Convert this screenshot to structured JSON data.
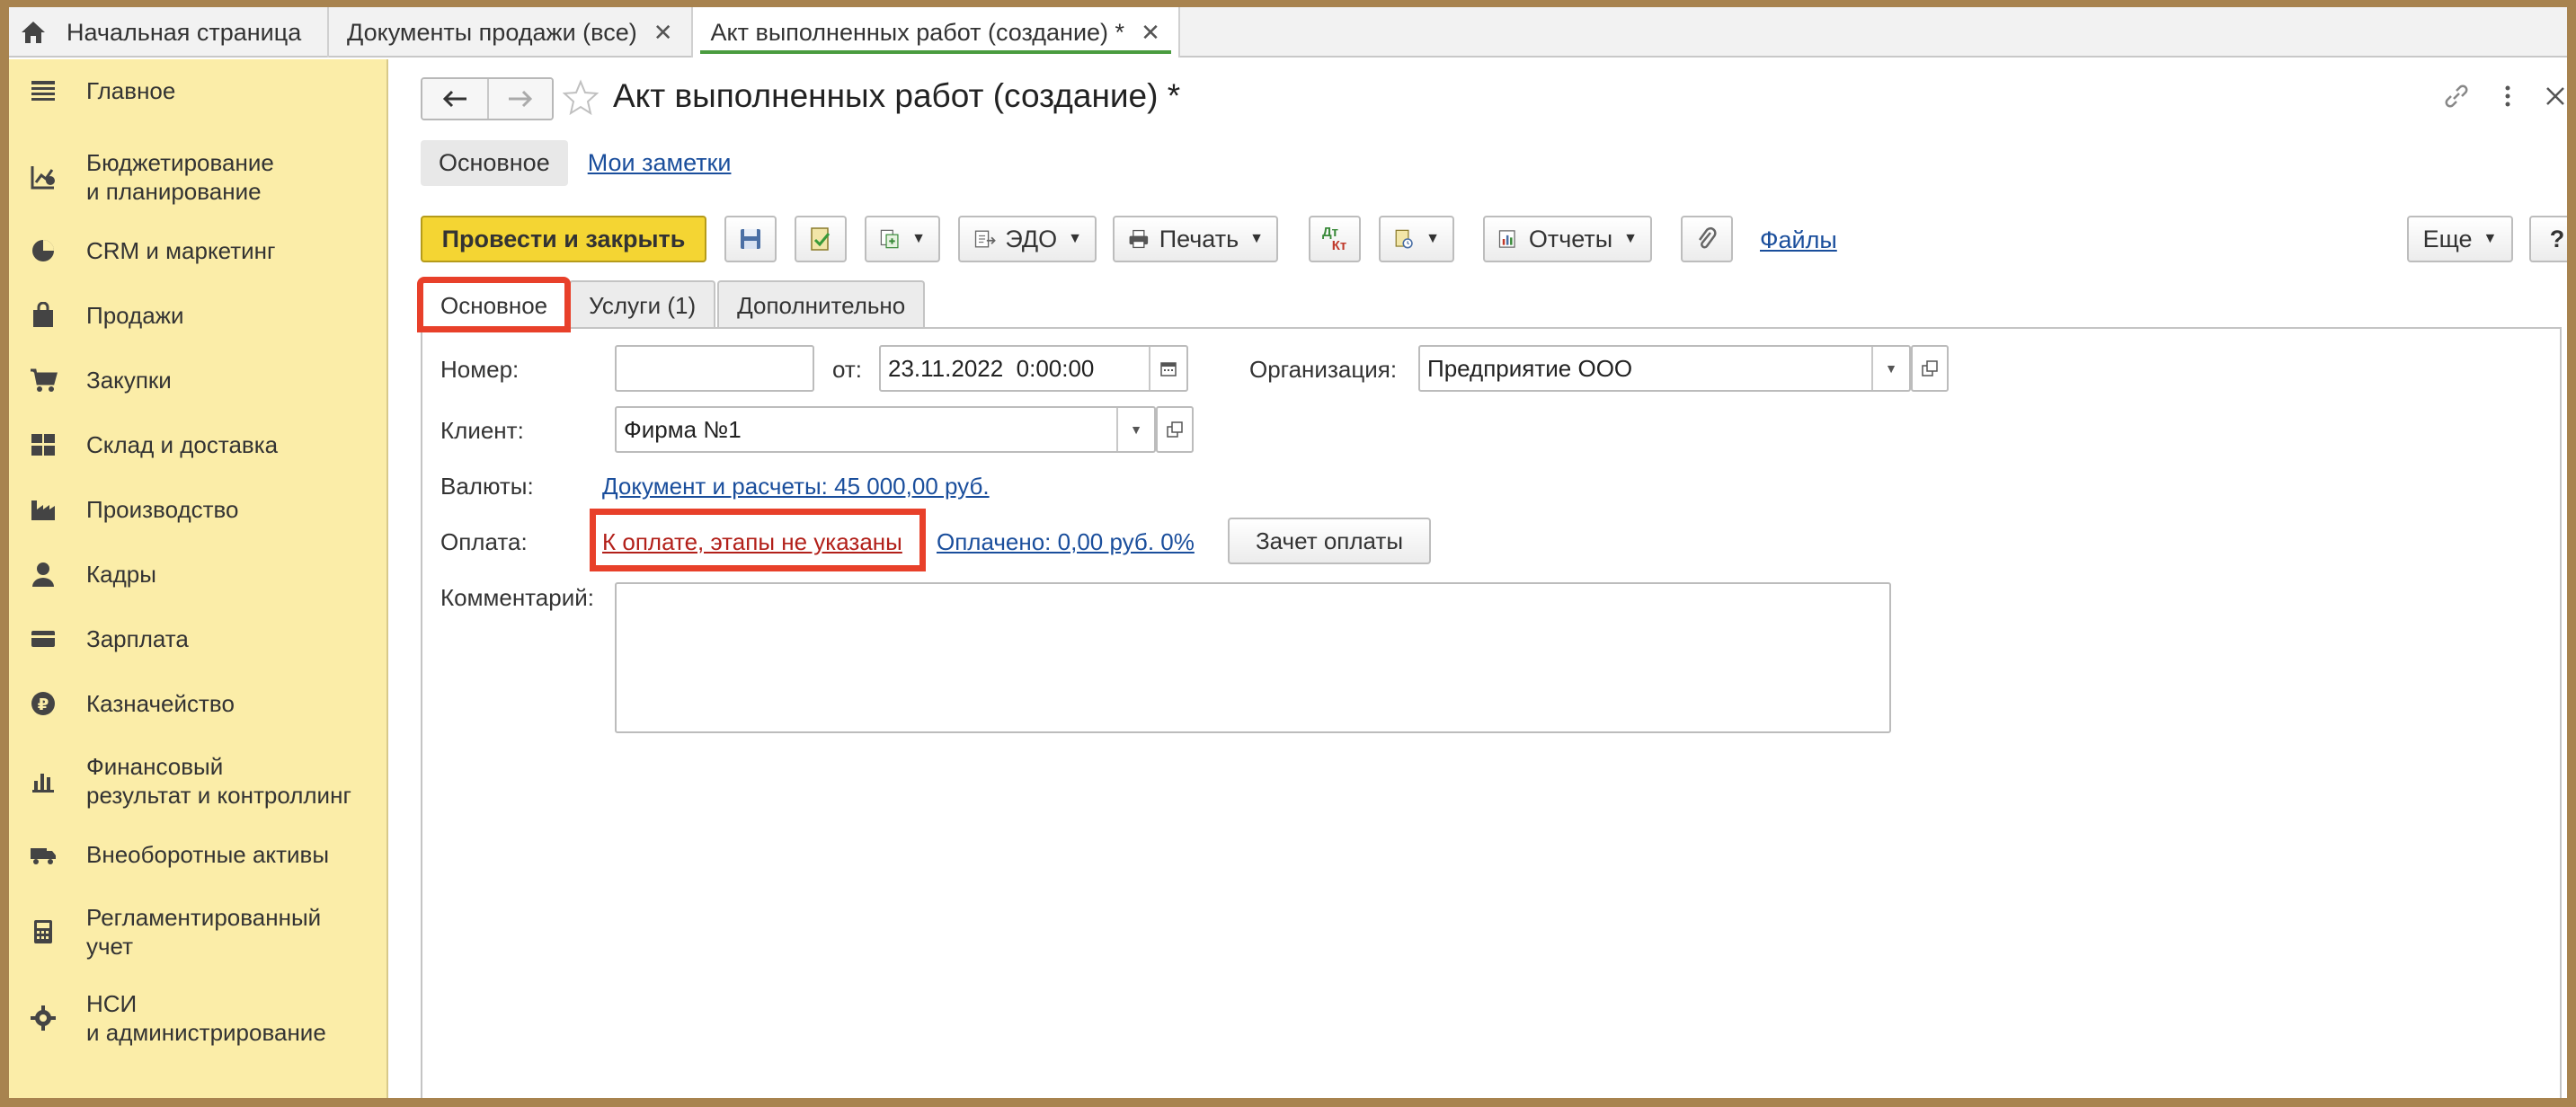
{
  "tabs": [
    {
      "label": "Начальная страница"
    },
    {
      "label": "Документы продажи (все)"
    },
    {
      "label": "Акт выполненных работ (создание) *"
    }
  ],
  "sidebar": {
    "items": [
      {
        "label": "Главное",
        "icon": "menu-lines-icon"
      },
      {
        "label": "Бюджетирование\nи планирование",
        "icon": "budget-chart-icon"
      },
      {
        "label": "CRM и маркетинг",
        "icon": "pie-chart-icon"
      },
      {
        "label": "Продажи",
        "icon": "shopping-bag-icon"
      },
      {
        "label": "Закупки",
        "icon": "cart-icon"
      },
      {
        "label": "Склад и доставка",
        "icon": "warehouse-icon"
      },
      {
        "label": "Производство",
        "icon": "factory-icon"
      },
      {
        "label": "Кадры",
        "icon": "person-icon"
      },
      {
        "label": "Зарплата",
        "icon": "card-icon"
      },
      {
        "label": "Казначейство",
        "icon": "ruble-icon"
      },
      {
        "label": "Финансовый\nрезультат и контроллинг",
        "icon": "bar-chart-icon"
      },
      {
        "label": "Внеоборотные активы",
        "icon": "truck-icon"
      },
      {
        "label": "Регламентированный\nучет",
        "icon": "calculator-icon"
      },
      {
        "label": "НСИ\nи администрирование",
        "icon": "gear-icon"
      }
    ]
  },
  "document": {
    "title": "Акт выполненных работ (создание) *",
    "subnav": {
      "main": "Основное",
      "notes": "Мои заметки"
    }
  },
  "toolbar": {
    "post_close": "Провести и закрыть",
    "edo": "ЭДО",
    "print": "Печать",
    "reports": "Отчеты",
    "files": "Файлы",
    "more": "Еще",
    "help": "?",
    "dtkt_dt": "Дт",
    "dtkt_kt": "Кт"
  },
  "form_tabs": [
    {
      "label": "Основное"
    },
    {
      "label": "Услуги (1)"
    },
    {
      "label": "Дополнительно"
    }
  ],
  "form": {
    "number_label": "Номер:",
    "number_value": "",
    "from_label": "от:",
    "date_value": "23.11.2022  0:00:00",
    "org_label": "Организация:",
    "org_value": "Предприятие ООО",
    "client_label": "Клиент:",
    "client_value": "Фирма №1",
    "currency_label": "Валюты:",
    "currency_link": "Документ и расчеты: 45 000,00 руб.",
    "payment_label": "Оплата:",
    "payment_link": "К оплате, этапы не указаны",
    "paid_link": "Оплачено: 0,00 руб. 0%",
    "offset_button": "Зачет оплаты",
    "comment_label": "Комментарий:",
    "comment_value": ""
  },
  "colors": {
    "sidebar_bg": "#fbeda8",
    "primary_button": "#f4d533",
    "highlight": "#e8402a",
    "link": "#1a4e9c",
    "link_red": "#b2201a",
    "active_tab_underline": "#4a9c3f"
  }
}
